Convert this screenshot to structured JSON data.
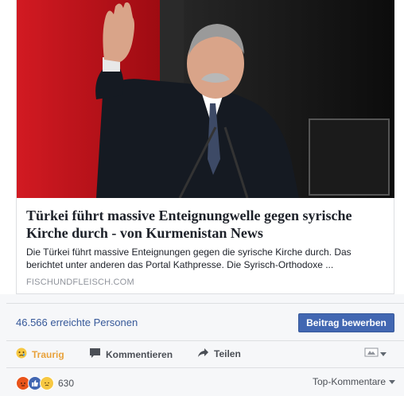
{
  "post": {
    "headline": "Türkei führt massive Enteignungwelle gegen syrische Kirche durch - von Kurmenistan News",
    "description": "Die Türkei führt massive Enteignungen gegen die syrische Kirche durch. Das berichtet unter anderen das Portal Kathpresse. Die Syrisch-Orthodoxe ...",
    "domain": "FISCHUNDFLEISCH.COM"
  },
  "stats": {
    "reach": "46.566 erreichte Personen",
    "boost_label": "Beitrag bewerben"
  },
  "actions": {
    "reaction_label": "Traurig",
    "comment_label": "Kommentieren",
    "share_label": "Teilen"
  },
  "footer": {
    "reaction_count": "630",
    "sort_label": "Top-Kommentare"
  },
  "colors": {
    "link_blue": "#365899",
    "button_blue": "#4267b2",
    "sad_yellow": "#e9a23b",
    "curtain_red": "#c8101a"
  },
  "icons": [
    "sad-emoji-icon",
    "comment-icon",
    "share-arrow-icon",
    "chevron-down-icon",
    "angry-reaction-icon",
    "like-reaction-icon",
    "sad-reaction-icon"
  ]
}
